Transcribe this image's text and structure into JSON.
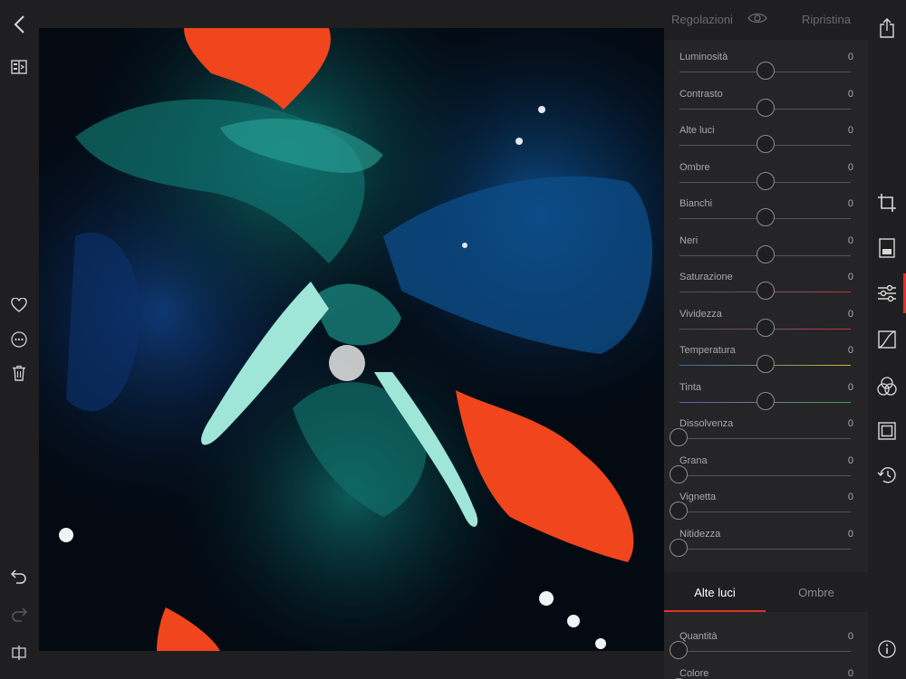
{
  "left_toolbar": {
    "icons": [
      "back-icon",
      "compare-icon",
      "heart-icon",
      "more-icon",
      "trash-icon",
      "undo-icon",
      "redo-icon",
      "split-view-icon"
    ]
  },
  "header": {
    "title": "Regolazioni",
    "reset_label": "Ripristina"
  },
  "sliders": [
    {
      "label": "Luminosità",
      "value": "0",
      "level": 0.5,
      "track": "plain"
    },
    {
      "label": "Contrasto",
      "value": "0",
      "level": 0.5,
      "track": "plain"
    },
    {
      "label": "Alte luci",
      "value": "0",
      "level": 0.5,
      "track": "plain"
    },
    {
      "label": "Ombre",
      "value": "0",
      "level": 0.5,
      "track": "plain"
    },
    {
      "label": "Bianchi",
      "value": "0",
      "level": 0.5,
      "track": "plain"
    },
    {
      "label": "Neri",
      "value": "0",
      "level": 0.5,
      "track": "plain"
    },
    {
      "label": "Saturazione",
      "value": "0",
      "level": 0.5,
      "track": "saturation"
    },
    {
      "label": "Vividezza",
      "value": "0",
      "level": 0.5,
      "track": "saturation"
    },
    {
      "label": "Temperatura",
      "value": "0",
      "level": 0.5,
      "track": "temperature"
    },
    {
      "label": "Tinta",
      "value": "0",
      "level": 0.5,
      "track": "tint"
    },
    {
      "label": "Dissolvenza",
      "value": "0",
      "level": 0,
      "track": "plain"
    },
    {
      "label": "Grana",
      "value": "0",
      "level": 0,
      "track": "plain"
    },
    {
      "label": "Vignetta",
      "value": "0",
      "level": 0,
      "track": "plain"
    },
    {
      "label": "Nitidezza",
      "value": "0",
      "level": 0,
      "track": "plain"
    }
  ],
  "tabs": [
    {
      "label": "Alte luci",
      "active": true
    },
    {
      "label": "Ombre",
      "active": false
    }
  ],
  "sub_sliders": [
    {
      "label": "Quantità",
      "value": "0",
      "level": 0
    },
    {
      "label": "Colore",
      "value": "0",
      "level": 0
    }
  ],
  "right_toolbar": {
    "icons": [
      "share-icon",
      "crop-icon",
      "presets-icon",
      "adjustments-icon",
      "curves-icon",
      "color-mix-icon",
      "frame-icon",
      "history-icon",
      "info-icon"
    ],
    "active": "adjustments-icon"
  },
  "colors": {
    "accent": "#e0312b",
    "background": "#1c1c1e",
    "panel": "#252527"
  },
  "canvas": {
    "image": "abstract fluid art artwork"
  }
}
